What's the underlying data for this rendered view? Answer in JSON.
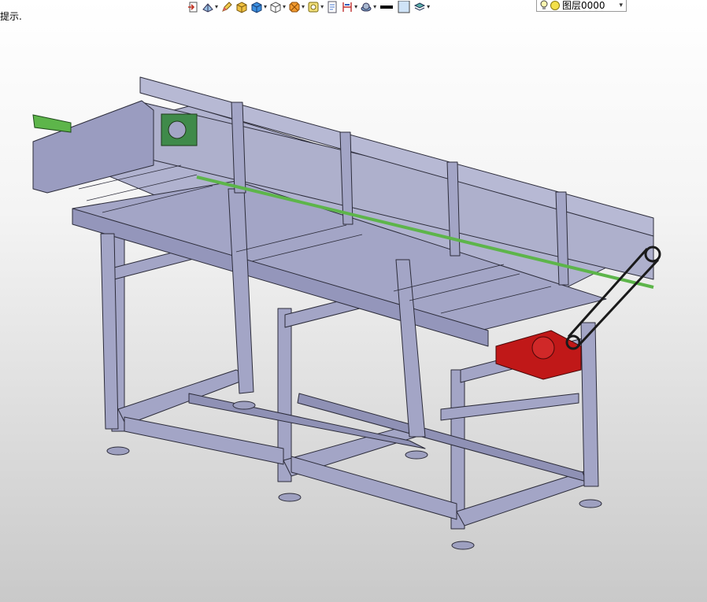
{
  "status": {
    "hint_text": "提示."
  },
  "toolbar": {
    "buttons": [
      {
        "icon": "exit-view-icon",
        "dropdown": false
      },
      {
        "icon": "view-orientation-icon",
        "dropdown": true
      },
      {
        "icon": "pencil-sketch-icon",
        "dropdown": false
      },
      {
        "icon": "shaded-cube-icon",
        "dropdown": false
      },
      {
        "icon": "render-style-icon",
        "dropdown": true
      },
      {
        "icon": "wireframe-cube-icon",
        "dropdown": true
      },
      {
        "icon": "orange-octagon-icon",
        "dropdown": true
      },
      {
        "icon": "sheet-metal-icon",
        "dropdown": true
      },
      {
        "icon": "document-sheet-icon",
        "dropdown": false
      },
      {
        "icon": "dimension-icon",
        "dropdown": true
      },
      {
        "icon": "material-sphere-icon",
        "dropdown": true
      },
      {
        "icon": "line-weight-icon",
        "dropdown": false
      },
      {
        "icon": "color-swatch-icon",
        "dropdown": false
      },
      {
        "icon": "layers-icon",
        "dropdown": true
      }
    ],
    "layer": {
      "name": "图层0000"
    }
  },
  "colors": {
    "frame": "#a3a5c6",
    "frame_dark": "#7d7fa3",
    "outline": "#2c2c3a",
    "green": "#5db54a",
    "motor": "#c01818"
  }
}
